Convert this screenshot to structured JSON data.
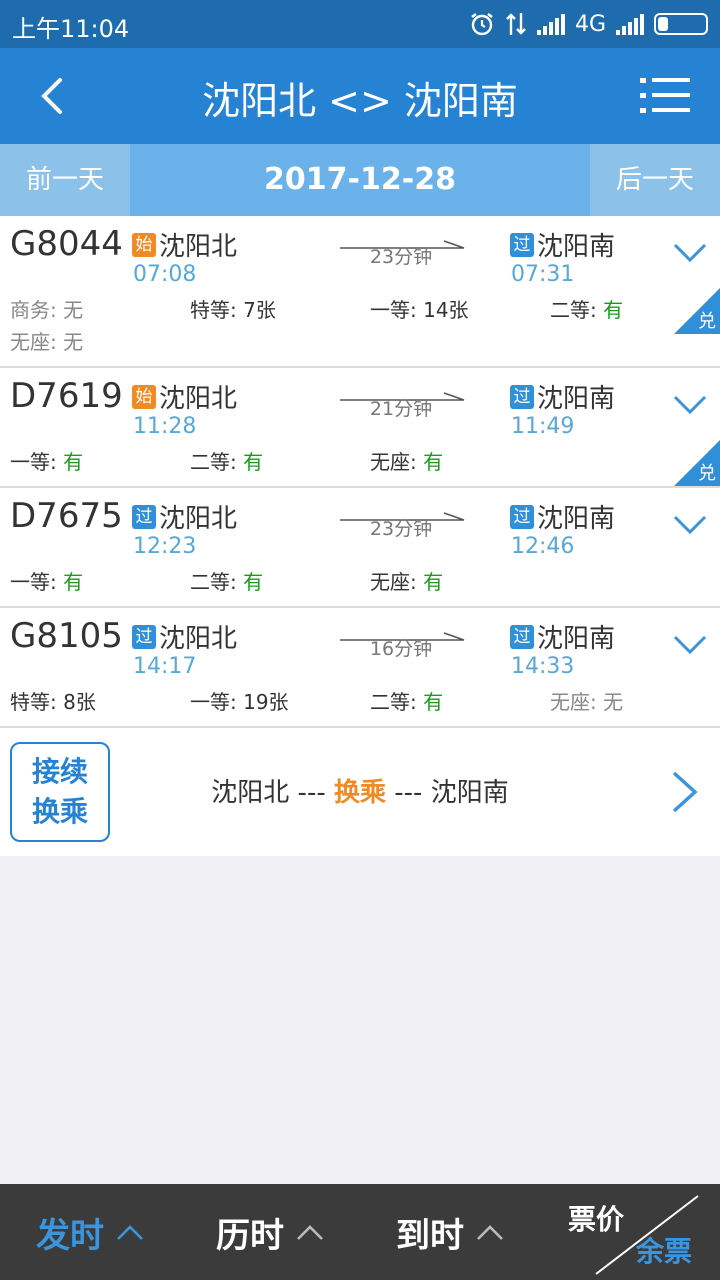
{
  "status_bar": {
    "time": "上午11:04",
    "network": "4G"
  },
  "nav": {
    "title": "沈阳北 <> 沈阳南"
  },
  "date_bar": {
    "prev_label": "前一天",
    "date": "2017-12-28",
    "next_label": "后一天"
  },
  "trains": [
    {
      "code": "G8044",
      "from": {
        "tag": "始",
        "station": "沈阳北",
        "time": "07:08"
      },
      "to": {
        "tag": "过",
        "station": "沈阳南",
        "time": "07:31"
      },
      "duration": "23分钟",
      "seats": [
        {
          "label": "商务:",
          "value": "无"
        },
        {
          "label": "特等:",
          "value": "7张"
        },
        {
          "label": "一等:",
          "value": "14张"
        },
        {
          "label": "二等:",
          "value": "有"
        },
        {
          "label": "无座:",
          "value": "无"
        }
      ],
      "exchange": "兑"
    },
    {
      "code": "D7619",
      "from": {
        "tag": "始",
        "station": "沈阳北",
        "time": "11:28"
      },
      "to": {
        "tag": "过",
        "station": "沈阳南",
        "time": "11:49"
      },
      "duration": "21分钟",
      "seats": [
        {
          "label": "一等:",
          "value": "有"
        },
        {
          "label": "二等:",
          "value": "有"
        },
        {
          "label": "无座:",
          "value": "有"
        }
      ],
      "exchange": "兑"
    },
    {
      "code": "D7675",
      "from": {
        "tag": "过",
        "station": "沈阳北",
        "time": "12:23"
      },
      "to": {
        "tag": "过",
        "station": "沈阳南",
        "time": "12:46"
      },
      "duration": "23分钟",
      "seats": [
        {
          "label": "一等:",
          "value": "有"
        },
        {
          "label": "二等:",
          "value": "有"
        },
        {
          "label": "无座:",
          "value": "有"
        }
      ]
    },
    {
      "code": "G8105",
      "from": {
        "tag": "过",
        "station": "沈阳北",
        "time": "14:17"
      },
      "to": {
        "tag": "过",
        "station": "沈阳南",
        "time": "14:33"
      },
      "duration": "16分钟",
      "seats": [
        {
          "label": "特等:",
          "value": "8张"
        },
        {
          "label": "一等:",
          "value": "19张"
        },
        {
          "label": "二等:",
          "value": "有"
        },
        {
          "label": "无座:",
          "value": "无"
        }
      ]
    }
  ],
  "transfer": {
    "badge_line1": "接续",
    "badge_line2": "换乘",
    "from": "沈阳北",
    "sep1": " --- ",
    "middle": "换乘",
    "sep2": " --- ",
    "to": "沈阳南"
  },
  "bottom_bar": {
    "depart": "发时",
    "duration": "历时",
    "arrive": "到时",
    "price": "票价",
    "remaining": "余票"
  },
  "colors": {
    "primary": "#2683d4",
    "status_bar": "#1e6cad",
    "available": "#1a9a1a",
    "origin_tag": "#f08a24",
    "pass_tag": "#2f8fd8",
    "bottom_bar": "#3b3b3b"
  }
}
